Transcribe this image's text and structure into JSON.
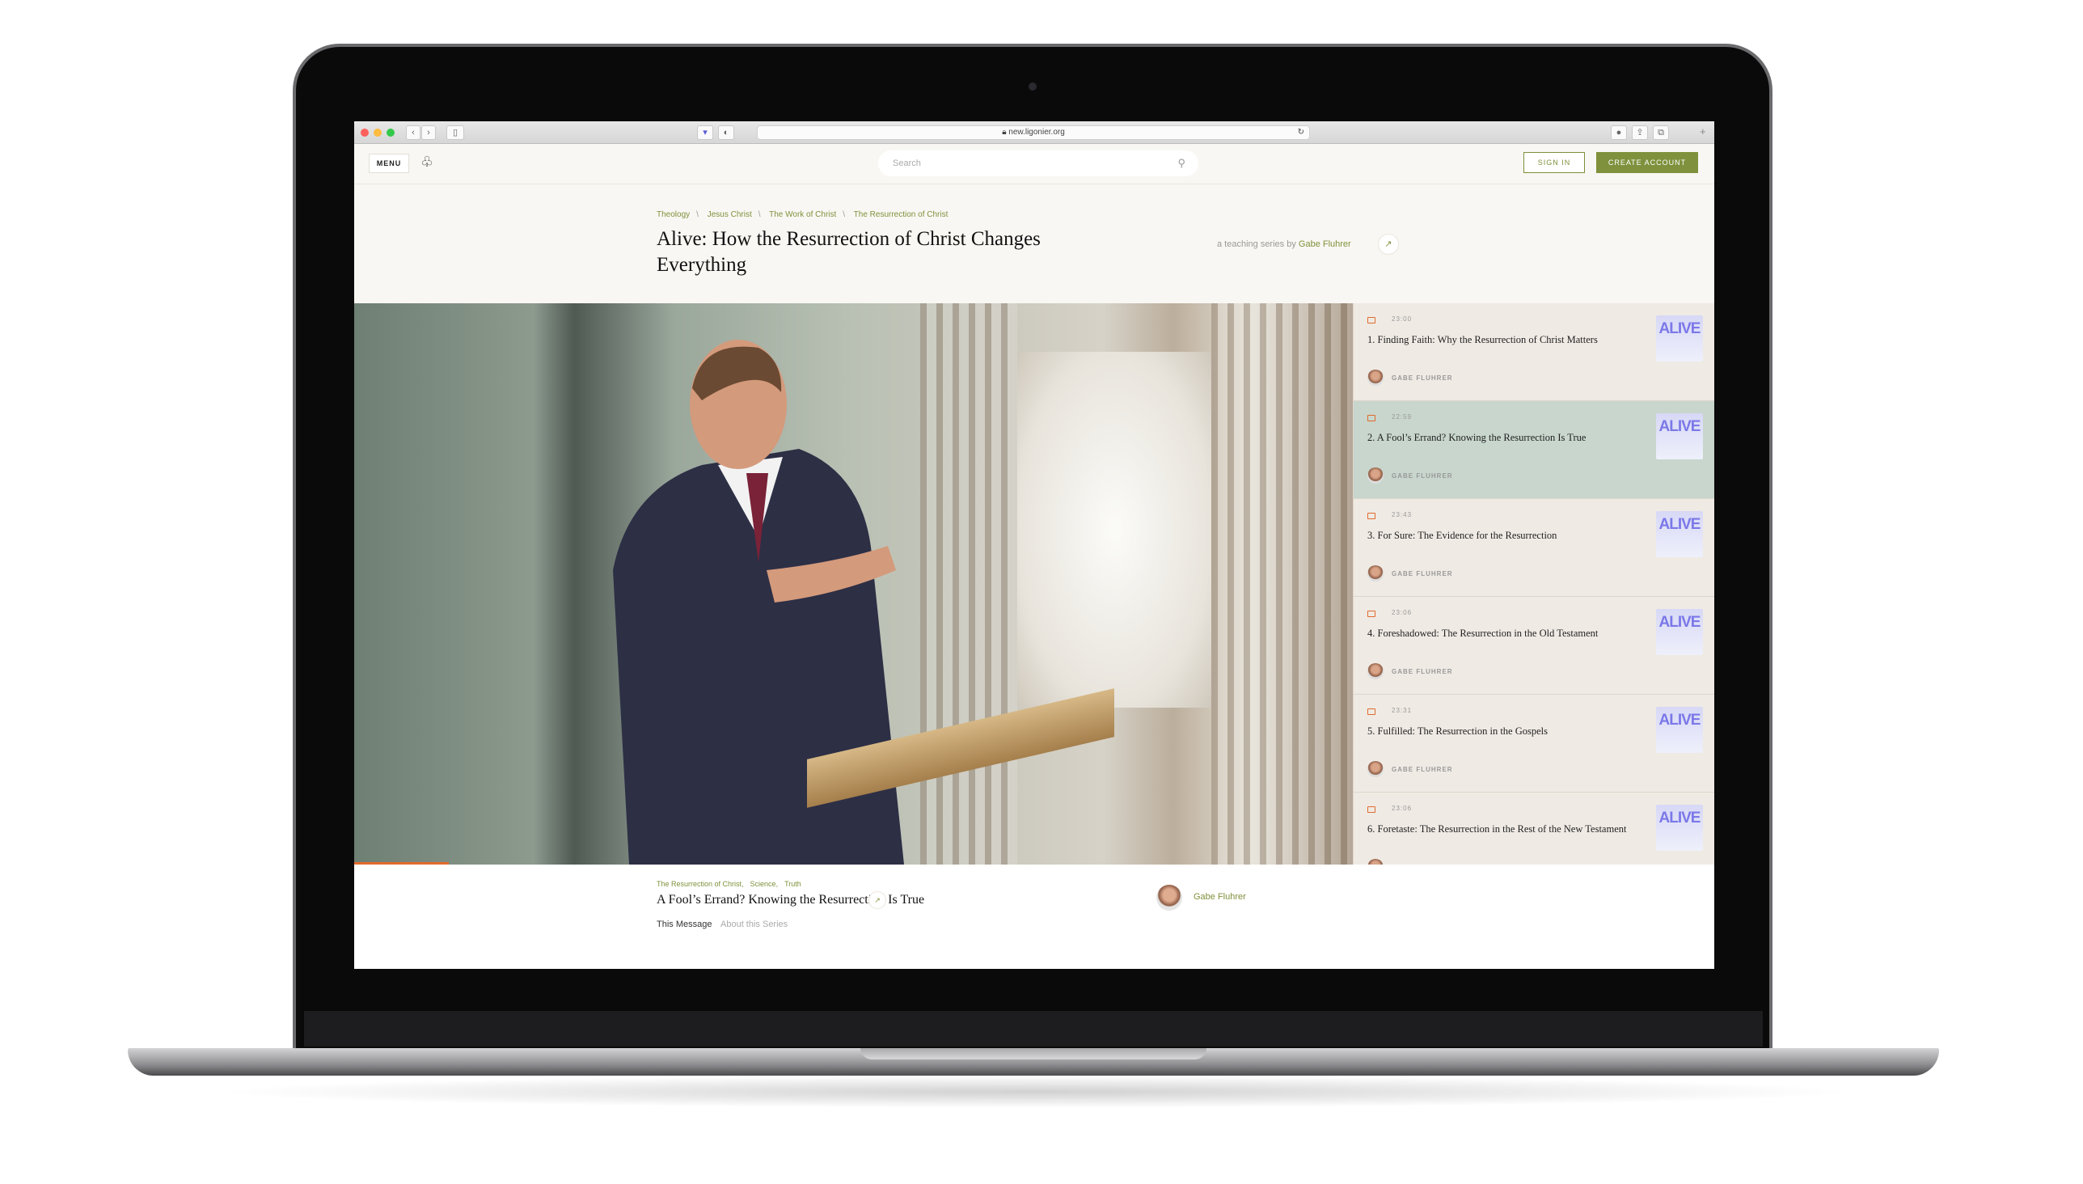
{
  "browser": {
    "url": "new.ligonier.org",
    "traffic_lights": [
      "#fc605c",
      "#fdbc40",
      "#34c84a"
    ]
  },
  "header": {
    "menu_label": "MENU",
    "logo_icon": "ligonier-logo-icon",
    "search_placeholder": "Search",
    "sign_in_label": "SIGN IN",
    "create_account_label": "CREATE ACCOUNT",
    "accent": "#7f913c"
  },
  "breadcrumbs": [
    "Theology",
    "Jesus Christ",
    "The Work of Christ",
    "The Resurrection of Christ"
  ],
  "series": {
    "title": "Alive: How the Resurrection of Christ Changes Everything",
    "byline_prefix": "a teaching series by",
    "author": "Gabe Fluhrer"
  },
  "video": {
    "progress_percent": 9.5,
    "progress_color": "#e26a2c"
  },
  "playlist": [
    {
      "duration": "23:00",
      "title": "1. Finding Faith: Why the Resurrection of Christ Matters",
      "author": "GABE FLUHRER",
      "thumb": "ALIVE",
      "active": false
    },
    {
      "duration": "22:59",
      "title": "2. A Fool’s Errand? Knowing the Resurrection Is True",
      "author": "GABE FLUHRER",
      "thumb": "ALIVE",
      "active": true
    },
    {
      "duration": "23:43",
      "title": "3. For Sure: The Evidence for the Resurrection",
      "author": "GABE FLUHRER",
      "thumb": "ALIVE",
      "active": false
    },
    {
      "duration": "23:06",
      "title": "4. Foreshadowed: The Resurrection in the Old Testament",
      "author": "GABE FLUHRER",
      "thumb": "ALIVE",
      "active": false
    },
    {
      "duration": "23:31",
      "title": "5. Fulfilled: The Resurrection in the Gospels",
      "author": "GABE FLUHRER",
      "thumb": "ALIVE",
      "active": false
    },
    {
      "duration": "23:06",
      "title": "6. Foretaste: The Resurrection in the Rest of the New Testament",
      "author": "GABE FLUHRER",
      "thumb": "ALIVE",
      "active": false
    }
  ],
  "message": {
    "tags": [
      "The Resurrection of Christ,",
      "Science,",
      "Truth"
    ],
    "title": "A Fool’s Errand? Knowing the Resurrection Is True",
    "tabs": [
      "This Message",
      "About this Series"
    ],
    "speaker": "Gabe Fluhrer"
  }
}
